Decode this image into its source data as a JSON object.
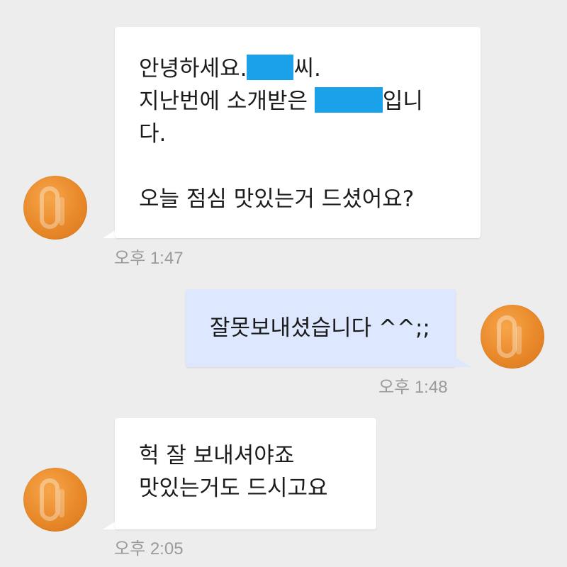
{
  "colors": {
    "background": "#ededed",
    "incoming_bubble": "#ffffff",
    "outgoing_bubble": "#dde8ff",
    "redaction": "#1aa1ea",
    "avatar": "#e8892a",
    "timestamp": "#9a9a9a"
  },
  "messages": [
    {
      "direction": "incoming",
      "avatar_icon": "orange-profile-avatar-icon",
      "lines": {
        "l1_pre": "안녕하세요.",
        "l1_post": "씨.",
        "l2_pre": "지난번에 소개받은 ",
        "l2_post": "입니",
        "l3": "다.",
        "l4": "",
        "l5": "오늘 점심 맛있는거 드셨어요?"
      },
      "time": "오후 1:47"
    },
    {
      "direction": "outgoing",
      "avatar_icon": "orange-profile-avatar-icon",
      "lines": {
        "l1": "잘못보내셨습니다 ^^;;"
      },
      "time": "오후 1:48"
    },
    {
      "direction": "incoming",
      "avatar_icon": "orange-profile-avatar-icon",
      "lines": {
        "l1": "헉 잘 보내셔야죠",
        "l2": "맛있는거도 드시고요"
      },
      "time": "오후 2:05"
    }
  ]
}
